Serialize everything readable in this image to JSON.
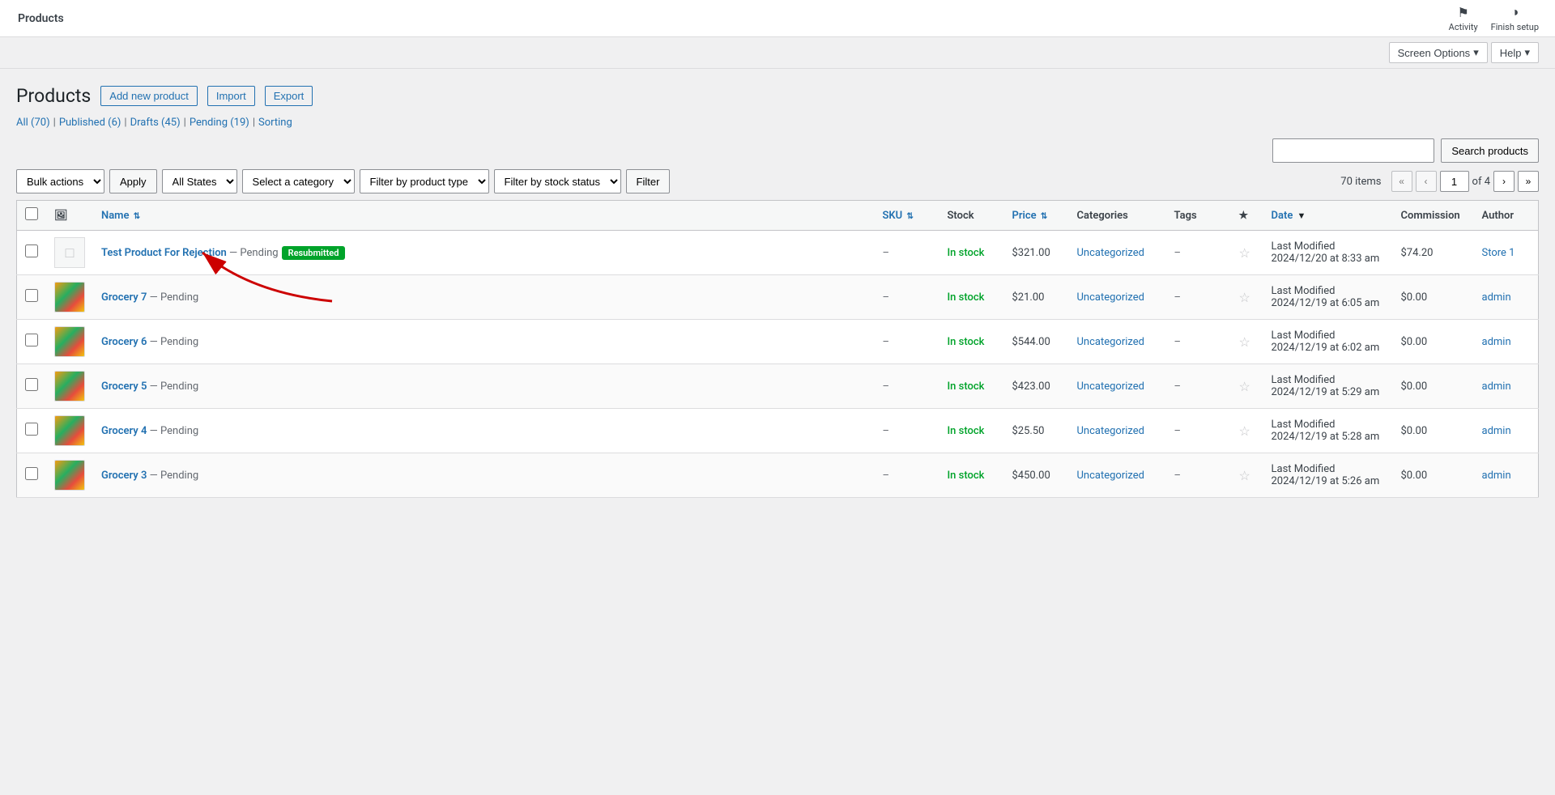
{
  "topbar": {
    "title": "Products",
    "activity_label": "Activity",
    "finish_setup_label": "Finish setup",
    "screen_options_label": "Screen Options",
    "help_label": "Help"
  },
  "page": {
    "title": "Products",
    "add_new_label": "Add new product",
    "import_label": "Import",
    "export_label": "Export"
  },
  "status_links": [
    {
      "label": "All (70)",
      "key": "all"
    },
    {
      "label": "Published (6)",
      "key": "published"
    },
    {
      "label": "Drafts (45)",
      "key": "drafts"
    },
    {
      "label": "Pending (19)",
      "key": "pending"
    },
    {
      "label": "Sorting",
      "key": "sorting"
    }
  ],
  "search": {
    "placeholder": "",
    "button_label": "Search products"
  },
  "filters": {
    "bulk_actions_label": "Bulk actions",
    "apply_label": "Apply",
    "all_states_label": "All States",
    "select_category_label": "Select a category",
    "filter_product_type_label": "Filter by product type",
    "filter_stock_status_label": "Filter by stock status",
    "filter_btn_label": "Filter"
  },
  "pagination": {
    "total": "70 items",
    "current_page": "1",
    "total_pages": "4"
  },
  "table": {
    "headers": [
      {
        "key": "name",
        "label": "Name",
        "sortable": true
      },
      {
        "key": "sku",
        "label": "SKU",
        "sortable": true
      },
      {
        "key": "stock",
        "label": "Stock",
        "sortable": false
      },
      {
        "key": "price",
        "label": "Price",
        "sortable": true
      },
      {
        "key": "categories",
        "label": "Categories",
        "sortable": false
      },
      {
        "key": "tags",
        "label": "Tags",
        "sortable": false
      },
      {
        "key": "featured",
        "label": "★",
        "sortable": false
      },
      {
        "key": "date",
        "label": "Date",
        "sortable": true,
        "sort_dir": "desc"
      },
      {
        "key": "commission",
        "label": "Commission",
        "sortable": false
      },
      {
        "key": "author",
        "label": "Author",
        "sortable": false
      }
    ],
    "rows": [
      {
        "id": 1,
        "has_thumb": false,
        "name": "Test Product For Rejection",
        "status": "Pending",
        "badge": "Resubmitted",
        "sku": "–",
        "stock": "In stock",
        "price": "$321.00",
        "category": "Uncategorized",
        "tags": "–",
        "featured": false,
        "date_label": "Last Modified",
        "date_value": "2024/12/20 at 8:33 am",
        "commission": "$74.20",
        "author": "Store 1",
        "has_arrow": true
      },
      {
        "id": 2,
        "has_thumb": true,
        "name": "Grocery 7",
        "status": "Pending",
        "badge": null,
        "sku": "–",
        "stock": "In stock",
        "price": "$21.00",
        "category": "Uncategorized",
        "tags": "–",
        "featured": false,
        "date_label": "Last Modified",
        "date_value": "2024/12/19 at 6:05 am",
        "commission": "$0.00",
        "author": "admin",
        "has_arrow": false
      },
      {
        "id": 3,
        "has_thumb": true,
        "name": "Grocery 6",
        "status": "Pending",
        "badge": null,
        "sku": "–",
        "stock": "In stock",
        "price": "$544.00",
        "category": "Uncategorized",
        "tags": "–",
        "featured": false,
        "date_label": "Last Modified",
        "date_value": "2024/12/19 at 6:02 am",
        "commission": "$0.00",
        "author": "admin",
        "has_arrow": false
      },
      {
        "id": 4,
        "has_thumb": true,
        "name": "Grocery 5",
        "status": "Pending",
        "badge": null,
        "sku": "–",
        "stock": "In stock",
        "price": "$423.00",
        "category": "Uncategorized",
        "tags": "–",
        "featured": false,
        "date_label": "Last Modified",
        "date_value": "2024/12/19 at 5:29 am",
        "commission": "$0.00",
        "author": "admin",
        "has_arrow": false
      },
      {
        "id": 5,
        "has_thumb": true,
        "name": "Grocery 4",
        "status": "Pending",
        "badge": null,
        "sku": "–",
        "stock": "In stock",
        "price": "$25.50",
        "category": "Uncategorized",
        "tags": "–",
        "featured": false,
        "date_label": "Last Modified",
        "date_value": "2024/12/19 at 5:28 am",
        "commission": "$0.00",
        "author": "admin",
        "has_arrow": false
      },
      {
        "id": 6,
        "has_thumb": true,
        "name": "Grocery 3",
        "status": "Pending",
        "badge": null,
        "sku": "–",
        "stock": "In stock",
        "price": "$450.00",
        "category": "Uncategorized",
        "tags": "–",
        "featured": false,
        "date_label": "Last Modified",
        "date_value": "2024/12/19 at 5:26 am",
        "commission": "$0.00",
        "author": "admin",
        "has_arrow": false
      }
    ]
  }
}
